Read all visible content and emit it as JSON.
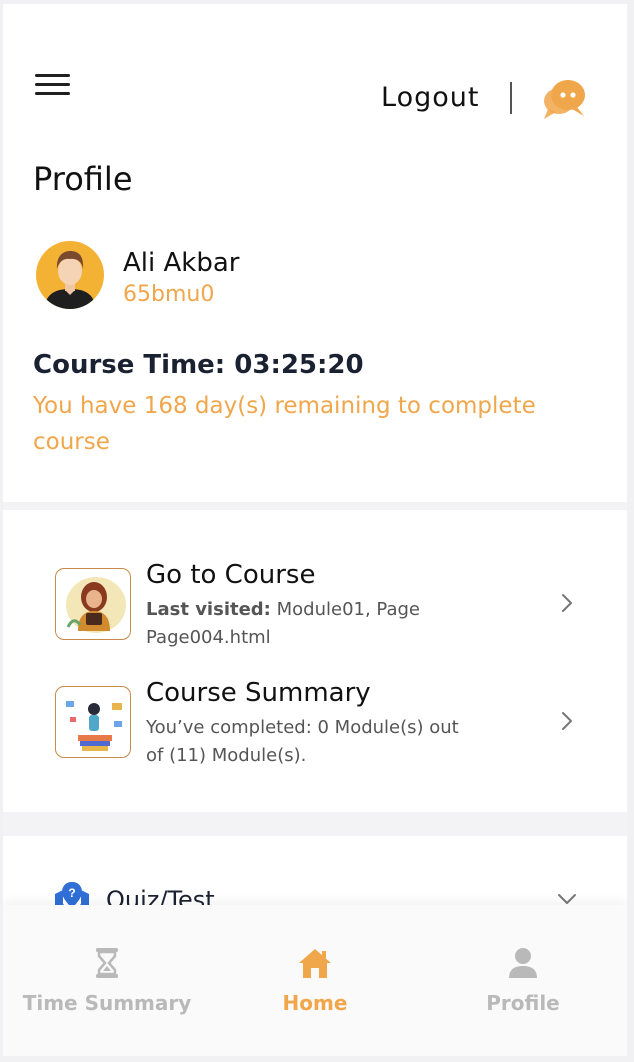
{
  "header": {
    "logout_label": "Logout",
    "menu_icon": "hamburger-menu-icon",
    "chat_icon": "chat-bubble-icon"
  },
  "profile": {
    "title": "Profile",
    "name": "Ali Akbar",
    "user_id": "65bmu0",
    "course_time": "Course Time: 03:25:20",
    "remaining": "You have 168 day(s) remaining to complete course"
  },
  "nav": {
    "go_to_course": {
      "title": "Go to Course",
      "last_visited_label": "Last visited:",
      "last_visited_value": " Module01, Page Page004.html"
    },
    "course_summary": {
      "title": "Course Summary",
      "subtitle": "You’ve completed: 0 Module(s) out of (11) Module(s)."
    }
  },
  "quiz": {
    "label": "Quiz/Test"
  },
  "tabs": [
    {
      "label": "Time Summary",
      "icon": "hourglass-icon",
      "active": false
    },
    {
      "label": "Home",
      "icon": "home-icon",
      "active": true
    },
    {
      "label": "Profile",
      "icon": "person-icon",
      "active": false
    }
  ],
  "colors": {
    "accent": "#f0a64a",
    "text_dark": "#1a2131",
    "inactive": "#b9b9b9"
  }
}
